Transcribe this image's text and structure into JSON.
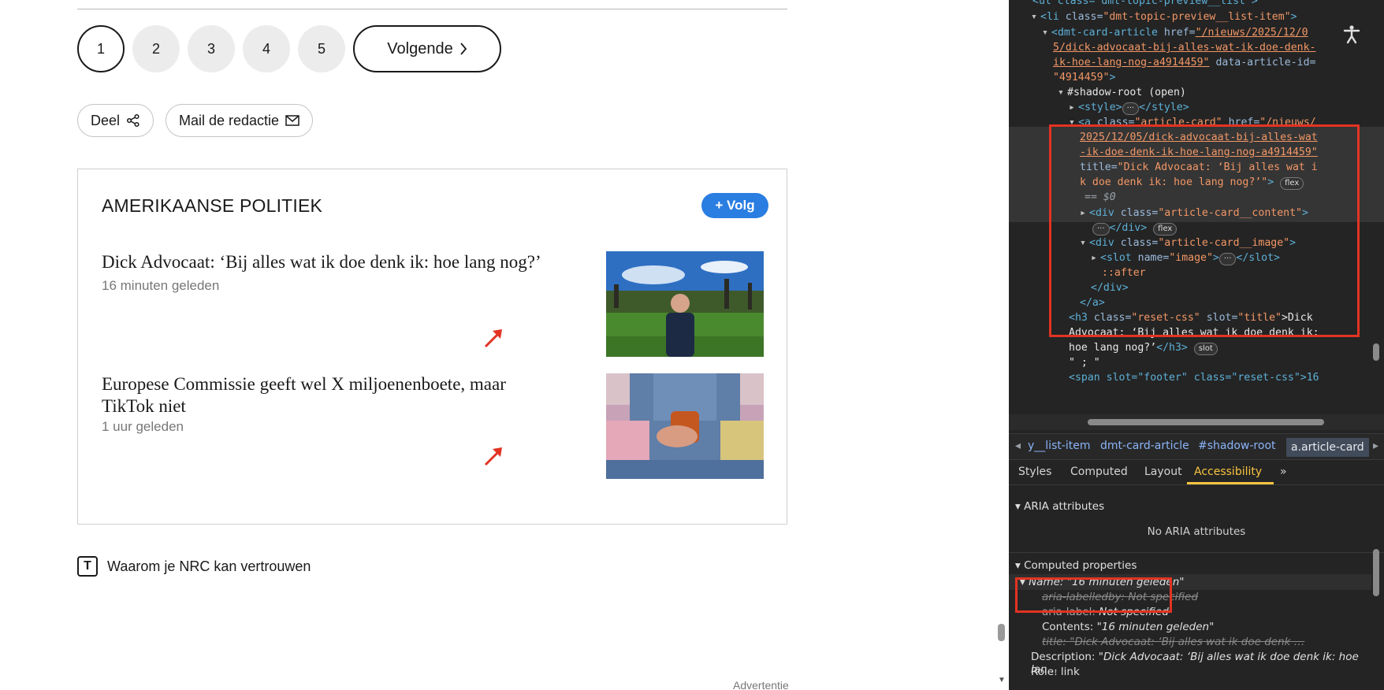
{
  "pagination": {
    "pages": [
      "1",
      "2",
      "3",
      "4",
      "5"
    ],
    "next_label": "Volgende"
  },
  "actions": {
    "share_label": "Deel",
    "mail_label": "Mail de redactie"
  },
  "topic": {
    "title": "AMERIKAANSE POLITIEK",
    "follow_label": "+ Volg",
    "articles": [
      {
        "title": "Dick Advocaat: ‘Bij alles wat ik doe denk ik: hoe lang nog?’",
        "time": "16 minuten geleden"
      },
      {
        "title": "Europese Commissie geeft wel X miljoenenboete, maar TikTok niet",
        "time": "1 uur geleden"
      }
    ]
  },
  "trust": {
    "label": "Waarom je NRC kan vertrouwen",
    "logo_letter": "T"
  },
  "ad_label": "Advertentie",
  "devtools": {
    "lines": {
      "l0": "<ul class=\"dmt-topic-preview__list\">",
      "l1_tag": "<li",
      "l1_attr": " class=",
      "l1_val": "\"dmt-topic-preview__list-item\"",
      "l1_end": ">",
      "l2_tag": "<dmt-card-article",
      "l2_attr": " href=",
      "l2_val_a": "\"/nieuws/2025/12/0",
      "l3_val": "5/dick-advocaat-bij-alles-wat-ik-doe-denk-",
      "l4_val": "ik-hoe-lang-nog-a4914459\"",
      "l4_attr": " data-article-id=",
      "l5_val": "\"4914459\"",
      "l5_end": ">",
      "l6": "#shadow-root (open)",
      "l7_tag": "<style>",
      "l7_end": "</style>",
      "l8_tag": "<a",
      "l8_attr": " class=",
      "l8_val": "\"article-card\"",
      "l8_attr2": " href=",
      "l8_val2": "\"/nieuws/",
      "l9_val": "2025/12/05/dick-advocaat-bij-alles-wat",
      "l10_val": "-ik-doe-denk-ik-hoe-lang-nog-a4914459\"",
      "l11_attr": "title=",
      "l11_val": "\"Dick Advocaat: ‘Bij alles wat i",
      "l12_val": "k doe denk ik: hoe lang nog?’\"",
      "l12_end": ">",
      "l13": "== $0",
      "l14_tag": "<div",
      "l14_attr": " class=",
      "l14_val": "\"article-card__content\"",
      "l14_end": ">",
      "l15_end": "</div>",
      "l16_tag": "<div",
      "l16_attr": " class=",
      "l16_val": "\"article-card__image\"",
      "l16_end": ">",
      "l17_tag": "<slot",
      "l17_attr": " name=",
      "l17_val": "\"image\"",
      "l17_end": ">",
      "l17_close": "</slot>",
      "l18": "::after",
      "l19": "</div>",
      "l20": "</a>",
      "l21_tag": "<h3",
      "l21_attr": " class=",
      "l21_val": "\"reset-css\"",
      "l21_attr2": " slot=",
      "l21_val2": "\"title\"",
      "l21_txt": ">Dick",
      "l22_txt": "Advocaat: ‘Bij alles wat ik doe denk ik:",
      "l23_txt": "hoe lang nog?’",
      "l23_tag": "</h3>",
      "l24_txt": "\" ; \"",
      "l25": "<span slot=\"footer\" class=\"reset-css\">16"
    },
    "badges": {
      "flex": "flex",
      "slot": "slot",
      "ellipsis": "···"
    },
    "breadcrumbs": [
      "y__list-item",
      "dmt-card-article",
      "#shadow-root",
      "a.article-card"
    ],
    "tabs": [
      "Styles",
      "Computed",
      "Layout",
      "Accessibility"
    ],
    "tabs_more": "»",
    "aria_section": "ARIA attributes",
    "aria_empty": "No ARIA attributes",
    "computed_section": "Computed properties",
    "name_line": "Name: \"16 minuten geleden\"",
    "labelledby_line": "aria-labelledby: Not specified",
    "label_key": "aria-label:",
    "label_val": "Not specified",
    "contents_key": "Contents:",
    "contents_val": "\"16 minuten geleden\"",
    "title_line": "title: \"Dick Advocaat: ‘Bij alles wat ik doe denk …",
    "description_key": "Description:",
    "description_val": "\"Dick Advocaat: ‘Bij alles wat ik doe denk ik: hoe lan…",
    "role_line": "Role: link"
  },
  "colors": {
    "accent_blue": "#2a7de1",
    "annotation_red": "#e33322",
    "devtools_bg": "#242424",
    "tab_active": "#f9c440"
  }
}
